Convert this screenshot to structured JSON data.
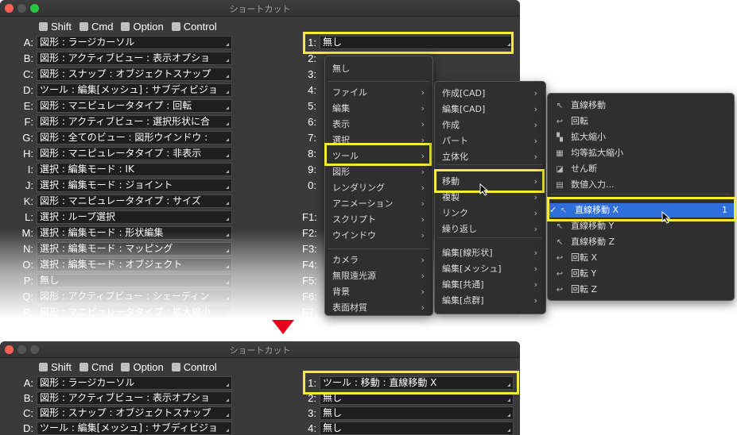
{
  "window": {
    "title": "ショートカット"
  },
  "modifiers": [
    "Shift",
    "Cmd",
    "Option",
    "Control"
  ],
  "left_rows": [
    {
      "key": "A:",
      "value": "図形 : ラージカーソル"
    },
    {
      "key": "B:",
      "value": "図形 : アクティブビュー : 表示オプショ"
    },
    {
      "key": "C:",
      "value": "図形 : スナップ : オブジェクトスナップ"
    },
    {
      "key": "D:",
      "value": "ツール : 編集[メッシュ] : サブディビジョ"
    },
    {
      "key": "E:",
      "value": "図形 : マニピュレータタイプ : 回転"
    },
    {
      "key": "F:",
      "value": "図形 : アクティブビュー : 選択形状に合"
    },
    {
      "key": "G:",
      "value": "図形 : 全てのビュー : 図形ウインドウ :"
    },
    {
      "key": "H:",
      "value": "図形 : マニピュレータタイプ : 非表示"
    },
    {
      "key": "I:",
      "value": "選択 : 編集モード : IK"
    },
    {
      "key": "J:",
      "value": "選択 : 編集モード : ジョイント"
    },
    {
      "key": "K:",
      "value": "図形 : マニピュレータタイプ : サイズ"
    },
    {
      "key": "L:",
      "value": "選択 : ループ選択"
    },
    {
      "key": "M:",
      "value": "選択 : 編集モード : 形状編集"
    },
    {
      "key": "N:",
      "value": "選択 : 編集モード : マッピング"
    },
    {
      "key": "O:",
      "value": "選択 : 編集モード : オブジェクト"
    },
    {
      "key": "P:",
      "value": "無し"
    },
    {
      "key": "Q:",
      "value": "図形 : アクティブビュー : シェーディン"
    },
    {
      "key": "R:",
      "value": "図形 : マニピュレータタイプ : 拡大縮小"
    }
  ],
  "right_keys": [
    "1:",
    "2:",
    "3:",
    "4:",
    "5:",
    "6:",
    "7:",
    "8:",
    "9:",
    "0:",
    "",
    "F1:",
    "F2:",
    "F3:",
    "F4:",
    "F5:",
    "F6:",
    "F7:"
  ],
  "right_first_value": "無し",
  "menu1": {
    "top": "無し",
    "items": [
      "ファイル",
      "編集",
      "表示",
      "選択",
      "ツール",
      "図形",
      "レンダリング",
      "アニメーション",
      "スクリプト",
      "ウインドウ"
    ],
    "items2": [
      "カメラ",
      "無限遠光源",
      "背景",
      "表面材質"
    ],
    "selected": "ツール"
  },
  "menu2": {
    "items": [
      "作成[CAD]",
      "編集[CAD]",
      "作成",
      "パート",
      "立体化"
    ],
    "items2": [
      "移動",
      "複製",
      "リンク",
      "繰り返し"
    ],
    "items3": [
      "編集[線形状]",
      "編集[メッシュ]",
      "編集[共通]",
      "編集[点群]"
    ],
    "selected": "移動"
  },
  "menu3": {
    "items": [
      "直線移動",
      "回転",
      "拡大縮小",
      "均等拡大縮小",
      "せん断",
      "数値入力..."
    ],
    "items2": [
      "直線移動 X",
      "直線移動 Y",
      "直線移動 Z",
      "回転 X",
      "回転 Y",
      "回転 Z"
    ],
    "selected": "直線移動 X",
    "selected_badge": "1",
    "check": "✓"
  },
  "window2": {
    "title": "ショートカット",
    "left_rows": [
      {
        "key": "A:",
        "value": "図形 : ラージカーソル"
      },
      {
        "key": "B:",
        "value": "図形 : アクティブビュー : 表示オプショ"
      },
      {
        "key": "C:",
        "value": "図形 : スナップ : オブジェクトスナップ"
      },
      {
        "key": "D:",
        "value": "ツール : 編集[メッシュ] : サブディビジョ"
      }
    ],
    "right_rows": [
      {
        "key": "1:",
        "value": "ツール : 移動 : 直線移動 X"
      },
      {
        "key": "2:",
        "value": "無し"
      },
      {
        "key": "3:",
        "value": "無し"
      },
      {
        "key": "4:",
        "value": "無し"
      }
    ]
  },
  "colors": {
    "highlight": "#f5ea37",
    "selection": "#2f6fdc",
    "arrow": "#e8001d"
  }
}
